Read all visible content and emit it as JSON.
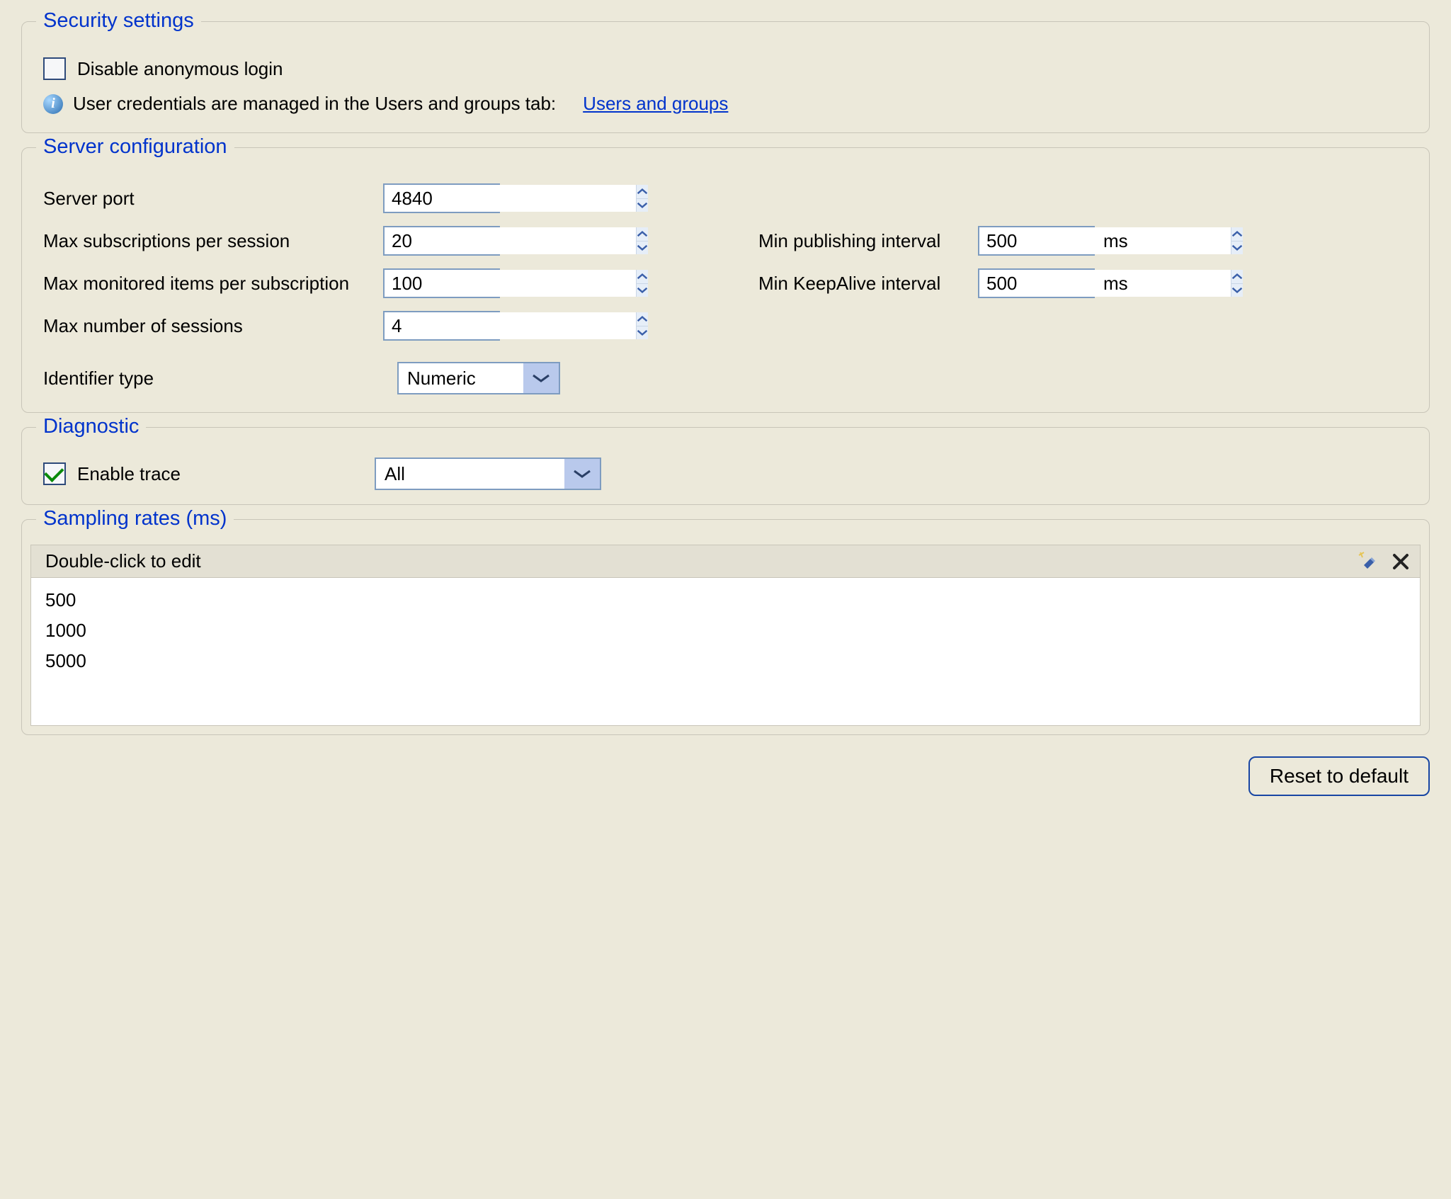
{
  "security": {
    "title": "Security settings",
    "disable_anonymous_label": "Disable anonymous login",
    "disable_anonymous_checked": false,
    "credentials_info": "User credentials are managed in the Users and groups tab:",
    "users_groups_link": "Users and groups"
  },
  "server": {
    "title": "Server configuration",
    "server_port_label": "Server port",
    "server_port": "4840",
    "max_subs_label": "Max subscriptions per session",
    "max_subs": "20",
    "max_items_label": "Max monitored items per subscription",
    "max_items": "100",
    "max_sessions_label": "Max number of sessions",
    "max_sessions": "4",
    "min_pub_label": "Min publishing interval",
    "min_pub": "500",
    "min_keep_label": "Min KeepAlive interval",
    "min_keep": "500",
    "unit_ms": "ms",
    "identifier_label": "Identifier type",
    "identifier_value": "Numeric"
  },
  "diagnostic": {
    "title": "Diagnostic",
    "enable_trace_label": "Enable trace",
    "enable_trace_checked": true,
    "trace_level": "All"
  },
  "sampling": {
    "title": "Sampling rates (ms)",
    "hint": "Double-click to edit",
    "rates": [
      "500",
      "1000",
      "5000"
    ]
  },
  "buttons": {
    "reset": "Reset to default"
  }
}
